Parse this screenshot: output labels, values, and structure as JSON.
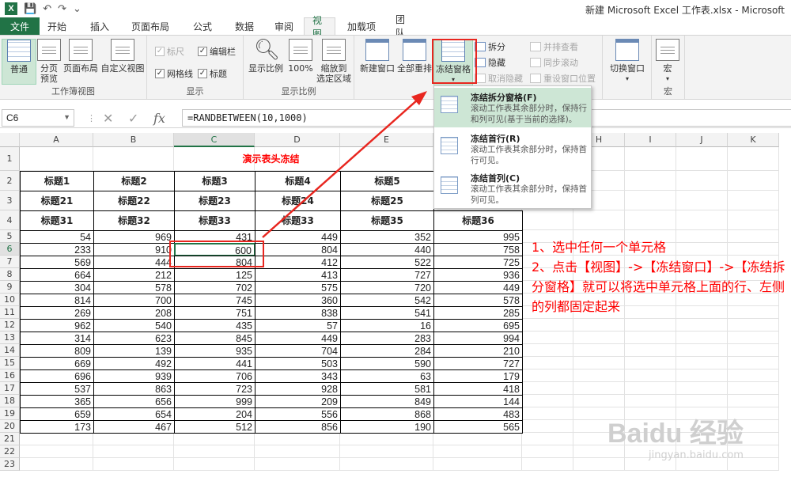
{
  "window": {
    "title": "新建 Microsoft Excel 工作表.xlsx - Microsoft Excel",
    "app_icon": "X"
  },
  "tabs": [
    "文件",
    "开始",
    "插入",
    "页面布局",
    "公式",
    "数据",
    "审阅",
    "视图",
    "加载项",
    "团队"
  ],
  "ribbon": {
    "groups": {
      "workbook_views": {
        "label": "工作簿视图",
        "buttons": [
          "普通",
          "分页\n预览",
          "页面布局",
          "自定义视图"
        ]
      },
      "show": {
        "label": "显示",
        "ruler": "标尺",
        "formula_bar": "编辑栏",
        "gridlines": "网格线",
        "headings": "标题"
      },
      "zoom": {
        "label": "显示比例",
        "zoom": "显示比例",
        "zoom100": "100%",
        "zoom_selection": "缩放到\n选定区域"
      },
      "window": {
        "new_window": "新建窗口",
        "arrange_all": "全部重排",
        "freeze_panes": "冻结窗格",
        "split": "拆分",
        "hide": "隐藏",
        "unhide": "取消隐藏",
        "view_side": "并排查看",
        "sync_scroll": "同步滚动",
        "reset_pos": "重设窗口位置",
        "switch_windows": "切换窗口"
      },
      "macros": {
        "label": "宏",
        "macros": "宏"
      }
    }
  },
  "formula_bar": {
    "name_box": "C6",
    "formula": "=RANDBETWEEN(10,1000)"
  },
  "columns": [
    "A",
    "B",
    "C",
    "D",
    "E",
    "F",
    "G",
    "H",
    "I",
    "J",
    "K"
  ],
  "rows": [
    "1",
    "2",
    "3",
    "4",
    "5",
    "6",
    "7",
    "8",
    "9",
    "10",
    "11",
    "12",
    "13",
    "14",
    "15",
    "16",
    "17",
    "18",
    "19",
    "20",
    "21",
    "22",
    "23"
  ],
  "sheet": {
    "title": "演示表头冻结",
    "header_rows": [
      [
        "标题1",
        "标题2",
        "标题3",
        "标题4",
        "标题5",
        ""
      ],
      [
        "标题21",
        "标题22",
        "标题23",
        "标题24",
        "标题25",
        ""
      ],
      [
        "标题31",
        "标题32",
        "标题33",
        "标题33",
        "标题35",
        "标题36"
      ]
    ],
    "data": [
      [
        54,
        969,
        431,
        449,
        352,
        995
      ],
      [
        233,
        910,
        600,
        804,
        440,
        758
      ],
      [
        569,
        444,
        804,
        412,
        522,
        725
      ],
      [
        664,
        212,
        125,
        413,
        727,
        936
      ],
      [
        304,
        578,
        702,
        575,
        720,
        449
      ],
      [
        814,
        700,
        745,
        360,
        542,
        578
      ],
      [
        269,
        208,
        751,
        838,
        541,
        285
      ],
      [
        962,
        540,
        435,
        57,
        16,
        695
      ],
      [
        314,
        623,
        845,
        449,
        283,
        994
      ],
      [
        809,
        139,
        935,
        704,
        284,
        210
      ],
      [
        669,
        492,
        441,
        503,
        590,
        727
      ],
      [
        696,
        939,
        706,
        343,
        63,
        179
      ],
      [
        537,
        863,
        723,
        928,
        581,
        418
      ],
      [
        365,
        656,
        999,
        209,
        849,
        144
      ],
      [
        659,
        654,
        204,
        556,
        868,
        483
      ],
      [
        173,
        467,
        512,
        856,
        190,
        565
      ]
    ]
  },
  "freeze_menu": {
    "items": [
      {
        "title": "冻结拆分窗格(F)",
        "desc": "滚动工作表其余部分时，保持行和列可见(基于当前的选择)。"
      },
      {
        "title": "冻结首行(R)",
        "desc": "滚动工作表其余部分时，保持首行可见。"
      },
      {
        "title": "冻结首列(C)",
        "desc": "滚动工作表其余部分时，保持首列可见。"
      }
    ]
  },
  "annotation": [
    "1、选中任何一个单元格",
    "2、点击【视图】->【冻结窗口】->【冻结拆分窗格】就可以将选中单元格上面的行、左侧的列都固定起来"
  ],
  "watermark": {
    "logo": "Baidu 经验",
    "url": "jingyan.baidu.com"
  },
  "colors": {
    "excel_green": "#217346",
    "annotation_red": "#ff0000",
    "highlight_green": "#cde6d5"
  }
}
